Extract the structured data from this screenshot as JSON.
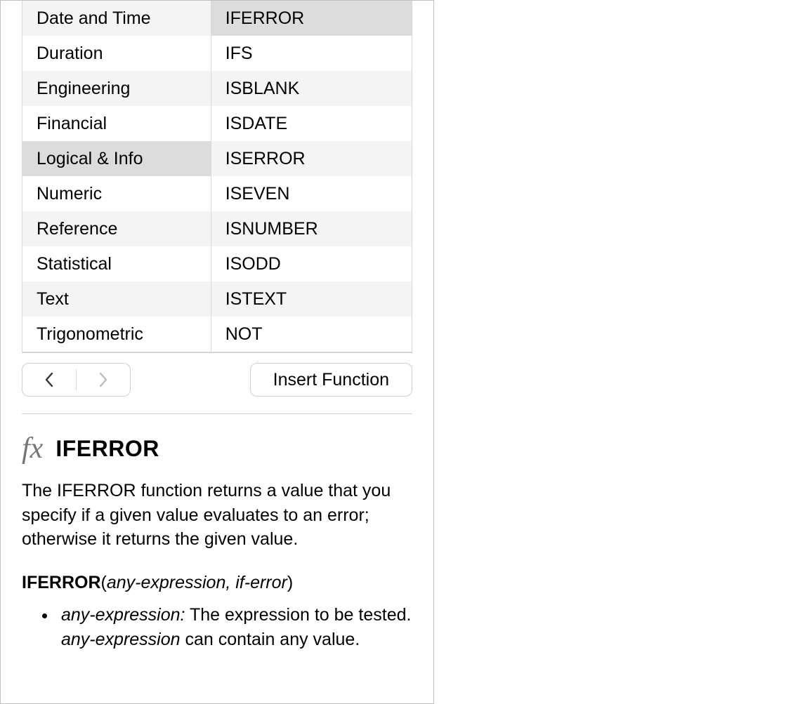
{
  "categories": [
    {
      "label": "Date and Time",
      "selected": false,
      "stripe": true
    },
    {
      "label": "Duration",
      "selected": false,
      "stripe": false
    },
    {
      "label": "Engineering",
      "selected": false,
      "stripe": true
    },
    {
      "label": "Financial",
      "selected": false,
      "stripe": false
    },
    {
      "label": "Logical & Info",
      "selected": true,
      "stripe": true
    },
    {
      "label": "Numeric",
      "selected": false,
      "stripe": false
    },
    {
      "label": "Reference",
      "selected": false,
      "stripe": true
    },
    {
      "label": "Statistical",
      "selected": false,
      "stripe": false
    },
    {
      "label": "Text",
      "selected": false,
      "stripe": true
    },
    {
      "label": "Trigonometric",
      "selected": false,
      "stripe": false
    }
  ],
  "functions": [
    {
      "label": "IFERROR",
      "selected": true,
      "stripe": true
    },
    {
      "label": "IFS",
      "selected": false,
      "stripe": false
    },
    {
      "label": "ISBLANK",
      "selected": false,
      "stripe": true
    },
    {
      "label": "ISDATE",
      "selected": false,
      "stripe": false
    },
    {
      "label": "ISERROR",
      "selected": false,
      "stripe": true
    },
    {
      "label": "ISEVEN",
      "selected": false,
      "stripe": false
    },
    {
      "label": "ISNUMBER",
      "selected": false,
      "stripe": true
    },
    {
      "label": "ISODD",
      "selected": false,
      "stripe": false
    },
    {
      "label": "ISTEXT",
      "selected": false,
      "stripe": true
    },
    {
      "label": "NOT",
      "selected": false,
      "stripe": false
    }
  ],
  "toolbar": {
    "insert_label": "Insert Function"
  },
  "help": {
    "title": "IFERROR",
    "description": "The IFERROR function returns a value that you specify if a given value evaluates to an error; otherwise it returns the given value.",
    "syntax_name": "IFERROR",
    "syntax_params": "any-expression, if-error",
    "params": [
      {
        "name": "any-expression:",
        "desc_part1": " The expression to be tested. ",
        "italic_mid": "any-expression",
        "desc_part2": " can contain any value."
      }
    ]
  }
}
